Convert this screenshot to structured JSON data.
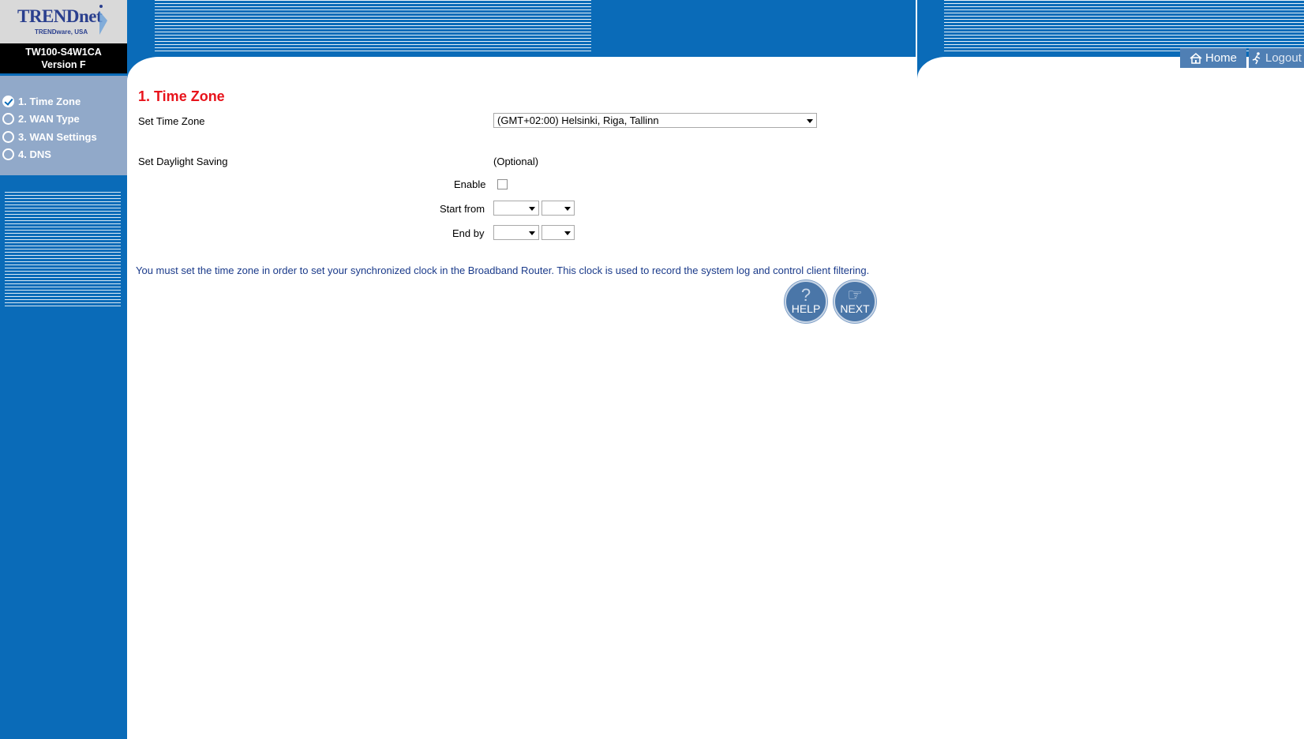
{
  "brand": {
    "logo": "TRENDnet",
    "logo_sub": "TRENDware, USA",
    "model": "TW100-S4W1CA",
    "version": "Version F"
  },
  "steps": [
    {
      "label": "1. Time Zone",
      "checked": true
    },
    {
      "label": "2. WAN Type",
      "checked": false
    },
    {
      "label": "3. WAN Settings",
      "checked": false
    },
    {
      "label": "4. DNS",
      "checked": false
    }
  ],
  "nav": {
    "home": "Home",
    "logout": "Logout"
  },
  "main": {
    "title": "1. Time Zone",
    "time_zone_label": "Set Time Zone",
    "time_zone_value": "(GMT+02:00) Helsinki, Riga, Tallinn",
    "daylight_label": "Set Daylight Saving",
    "optional_text": "(Optional)",
    "enable_label": "Enable",
    "enable_checked": false,
    "start_label": "Start from",
    "end_label": "End by",
    "start_month": "",
    "start_day": "",
    "end_month": "",
    "end_day": "",
    "info": "You must set the time zone in order to set your synchronized clock in the Broadband Router. This clock is used to record the system log and control client filtering.",
    "help_button": "HELP",
    "next_button": "NEXT"
  },
  "colors": {
    "primary_blue": "#0a6bb8",
    "step_panel": "#91a9c9",
    "title_red": "#e8131b",
    "info_text": "#1a3a8a"
  }
}
